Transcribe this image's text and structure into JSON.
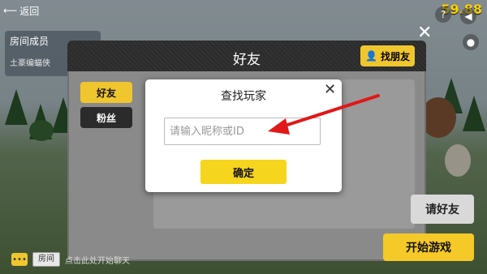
{
  "status": {
    "back_label": "返回",
    "fps": "59.88"
  },
  "room_members": {
    "title": "房间成员",
    "member_name": "土豪编蝠侠"
  },
  "friends_panel": {
    "title": "好友",
    "find_friend_label": "找朋友",
    "tabs": [
      {
        "label": "好友",
        "active": true
      },
      {
        "label": "粉丝",
        "active": false
      }
    ]
  },
  "find_player_dialog": {
    "title": "查找玩家",
    "input_placeholder": "请输入昵称或ID",
    "input_value": "",
    "confirm_label": "确定"
  },
  "actions": {
    "invite_label": "请好友",
    "start_label": "开始游戏"
  },
  "chat": {
    "channel_label": "房间",
    "hint": "点击此处开始聊天"
  },
  "colors": {
    "accent_yellow": "#f5d51e",
    "annotation_arrow": "#e01818",
    "fps_text": "#ffd200"
  }
}
